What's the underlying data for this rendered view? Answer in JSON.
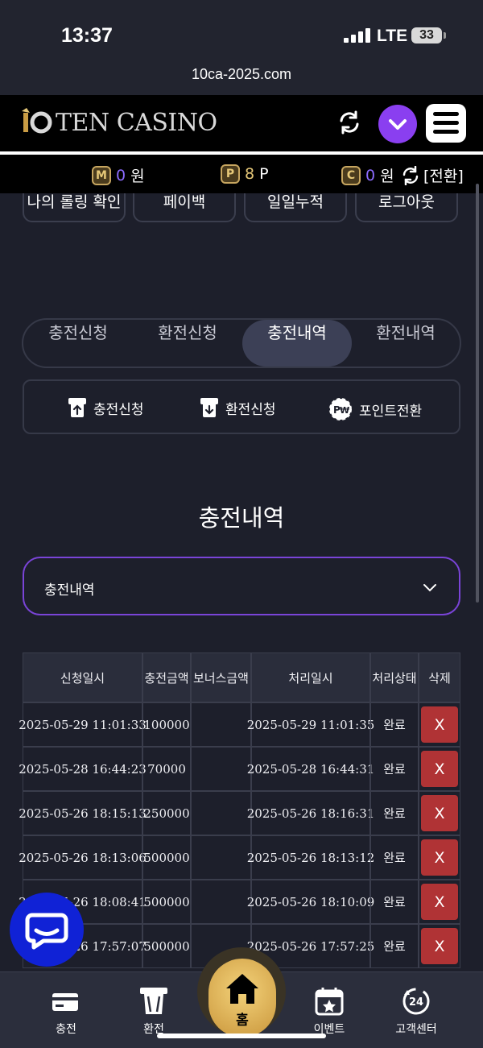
{
  "status": {
    "time": "13:37",
    "network": "LTE",
    "battery": "33",
    "url": "10ca-2025.com"
  },
  "brand": {
    "logo_text": "TEN CASINO"
  },
  "points": {
    "m_value": "0",
    "m_unit": "원",
    "p_value": "8",
    "p_unit": "P",
    "c_value": "0",
    "c_unit": "원",
    "switch_label": "[전환]"
  },
  "quick_buttons": [
    "나의 롤링 확인",
    "페이백",
    "일일누적",
    "로그아웃"
  ],
  "tabs": [
    {
      "label": "충전신청",
      "active": false
    },
    {
      "label": "환전신청",
      "active": false
    },
    {
      "label": "충전내역",
      "active": true
    },
    {
      "label": "환전내역",
      "active": false
    }
  ],
  "actions": [
    "충전신청",
    "환전신청",
    "포인트전환"
  ],
  "section_title": "충전내역",
  "filter": {
    "selected": "충전내역"
  },
  "table": {
    "headers": [
      "신청일시",
      "충전금액",
      "보너스금액",
      "처리일시",
      "처리상태",
      "삭제"
    ],
    "rows": [
      [
        "2025-05-29 11:01:33",
        "100000",
        "",
        "2025-05-29 11:01:35",
        "완료",
        "X"
      ],
      [
        "2025-05-28 16:44:23",
        "70000",
        "",
        "2025-05-28 16:44:31",
        "완료",
        "X"
      ],
      [
        "2025-05-26 18:15:13",
        "250000",
        "",
        "2025-05-26 18:16:31",
        "완료",
        "X"
      ],
      [
        "2025-05-26 18:13:06",
        "500000",
        "",
        "2025-05-26 18:13:12",
        "완료",
        "X"
      ],
      [
        "2025-05-26 18:08:41",
        "500000",
        "",
        "2025-05-26 18:10:09",
        "완료",
        "X"
      ],
      [
        "2025-05-26 17:57:07",
        "500000",
        "",
        "2025-05-26 17:57:25",
        "완료",
        "X"
      ]
    ]
  },
  "bottom_nav": {
    "deposit": "충전",
    "withdraw": "환전",
    "home": "홈",
    "event": "이벤트",
    "support": "고객센터",
    "support_badge": "24"
  },
  "colors": {
    "accent_purple": "#8a3ff0",
    "delete_red": "#b03335",
    "gold": "#e6c878",
    "background": "#1d1f2b"
  }
}
